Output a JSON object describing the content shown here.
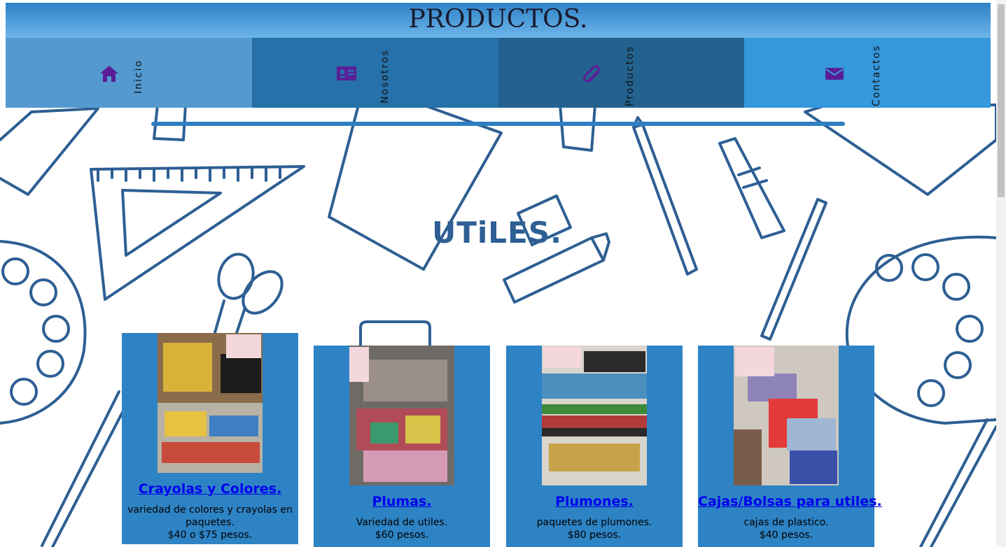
{
  "header": {
    "title": "PRODUCTOS."
  },
  "nav": {
    "items": [
      {
        "label": "Inicio",
        "icon": "home-icon",
        "bg": "#5499cf"
      },
      {
        "label": "Nosotros",
        "icon": "id-card-icon",
        "bg": "#2671a9"
      },
      {
        "label": "Productos",
        "icon": "paperclip-icon",
        "bg": "#23628f"
      },
      {
        "label": "Contactos",
        "icon": "envelope-icon",
        "bg": "#3597dc"
      }
    ],
    "icon_color": "#5b1e98"
  },
  "section": {
    "title": "UTiLES."
  },
  "products": [
    {
      "name": "Crayolas y Colores.",
      "description": "variedad de colores y crayolas en paquetes.",
      "price": "$40 o $75 pesos."
    },
    {
      "name": "Plumas.",
      "description": "Variedad de utiles.",
      "price": "$60 pesos."
    },
    {
      "name": "Plumones.",
      "description": "paquetes de plumones.",
      "price": "$80 pesos."
    },
    {
      "name": "Cajas/Bolsas para utiles.",
      "description": "cajas de plastico.",
      "price": "$40 pesos."
    }
  ],
  "colors": {
    "accent": "#2e83c4",
    "title_gradient_top": "#2f82c6",
    "doodle_line": "#2d5f93"
  }
}
